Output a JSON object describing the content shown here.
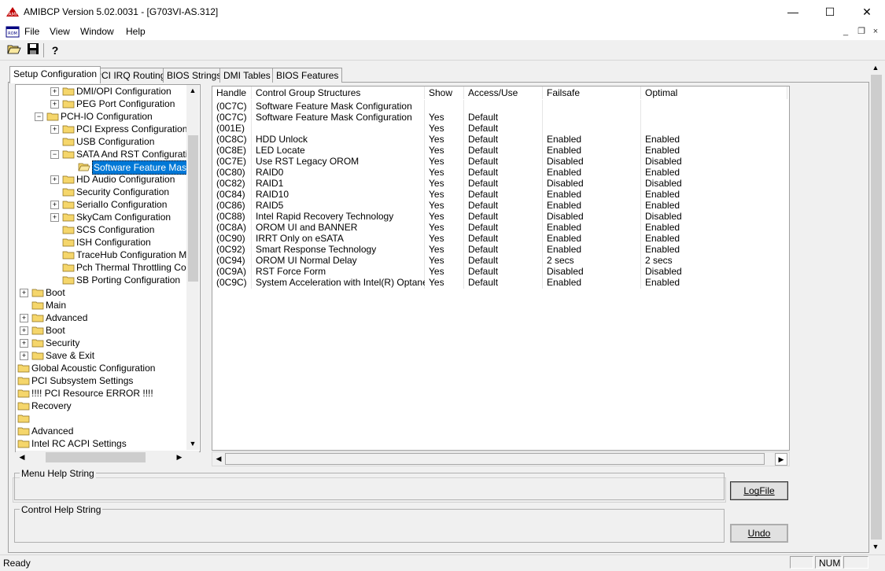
{
  "window": {
    "title": "AMIBCP Version 5.02.0031 - [G703VI-AS.312]",
    "minimize_glyph": "—",
    "maximize_glyph": "☐",
    "close_glyph": "✕"
  },
  "menubar": {
    "items": [
      "File",
      "View",
      "Window",
      "Help"
    ],
    "mdi_minimize": "_",
    "mdi_restore": "❐",
    "mdi_close": "×"
  },
  "toolbar": {
    "open_icon": "folder-open-icon",
    "save_icon": "floppy-disk-icon",
    "help_icon": "help-pointer-icon",
    "help_glyph": "?"
  },
  "tabs": [
    "Setup Configuration",
    "PCI IRQ Routing",
    "BIOS Strings",
    "DMI Tables",
    "BIOS Features"
  ],
  "tree": {
    "rows": [
      {
        "label": "DMI/OPI Configuration",
        "expander": "+"
      },
      {
        "label": "PEG Port Configuration",
        "expander": "+"
      },
      {
        "label": "PCH-IO Configuration",
        "expander": "−"
      },
      {
        "label": "PCI Express Configuration",
        "expander": "+"
      },
      {
        "label": "USB Configuration",
        "expander": ""
      },
      {
        "label": "SATA And RST Configuration",
        "expander": "−"
      },
      {
        "label": "Software Feature Mask Co",
        "expander": "",
        "selected": true
      },
      {
        "label": "HD Audio Configuration",
        "expander": "+"
      },
      {
        "label": "Security Configuration",
        "expander": ""
      },
      {
        "label": "SerialIo Configuration",
        "expander": "+"
      },
      {
        "label": "SkyCam Configuration",
        "expander": "+"
      },
      {
        "label": "SCS Configuration",
        "expander": ""
      },
      {
        "label": "ISH Configuration",
        "expander": ""
      },
      {
        "label": "TraceHub Configuration Menu",
        "expander": ""
      },
      {
        "label": "Pch Thermal Throttling Control",
        "expander": ""
      },
      {
        "label": "SB Porting Configuration",
        "expander": ""
      },
      {
        "label": "Boot",
        "expander": "+"
      },
      {
        "label": "Main",
        "expander": ""
      },
      {
        "label": "Advanced",
        "expander": "+"
      },
      {
        "label": "Boot",
        "expander": "+"
      },
      {
        "label": "Security",
        "expander": "+"
      },
      {
        "label": "Save & Exit",
        "expander": "+"
      },
      {
        "label": "Global Acoustic Configuration",
        "expander": ""
      },
      {
        "label": "PCI Subsystem Settings",
        "expander": ""
      },
      {
        "label": "!!!! PCI Resource ERROR !!!!",
        "expander": ""
      },
      {
        "label": "Recovery",
        "expander": ""
      },
      {
        "label": "",
        "expander": ""
      },
      {
        "label": "Advanced",
        "expander": ""
      },
      {
        "label": "Intel RC ACPI Settings",
        "expander": ""
      }
    ]
  },
  "grid": {
    "columns": [
      "Handle",
      "Control Group Structures",
      "Show",
      "Access/Use",
      "Failsafe",
      "Optimal"
    ],
    "rows": [
      [
        "(0C7C)",
        "Software Feature Mask Configuration",
        "",
        "",
        "",
        ""
      ],
      [
        "(0C7C)",
        "Software Feature Mask Configuration",
        "Yes",
        "Default",
        "",
        ""
      ],
      [
        "(001E)",
        "",
        "Yes",
        "Default",
        "",
        ""
      ],
      [
        "(0C8C)",
        "HDD Unlock",
        "Yes",
        "Default",
        "Enabled",
        "Enabled"
      ],
      [
        "(0C8E)",
        "LED Locate",
        "Yes",
        "Default",
        "Enabled",
        "Enabled"
      ],
      [
        "(0C7E)",
        "Use RST Legacy OROM",
        "Yes",
        "Default",
        "Disabled",
        "Disabled"
      ],
      [
        "(0C80)",
        "RAID0",
        "Yes",
        "Default",
        "Enabled",
        "Enabled"
      ],
      [
        "(0C82)",
        "RAID1",
        "Yes",
        "Default",
        "Disabled",
        "Disabled"
      ],
      [
        "(0C84)",
        "RAID10",
        "Yes",
        "Default",
        "Enabled",
        "Enabled"
      ],
      [
        "(0C86)",
        "RAID5",
        "Yes",
        "Default",
        "Enabled",
        "Enabled"
      ],
      [
        "(0C88)",
        "Intel Rapid Recovery Technology",
        "Yes",
        "Default",
        "Disabled",
        "Disabled"
      ],
      [
        "(0C8A)",
        "OROM UI and BANNER",
        "Yes",
        "Default",
        "Enabled",
        "Enabled"
      ],
      [
        "(0C90)",
        "IRRT Only on eSATA",
        "Yes",
        "Default",
        "Enabled",
        "Enabled"
      ],
      [
        "(0C92)",
        "Smart Response Technology",
        "Yes",
        "Default",
        "Enabled",
        "Enabled"
      ],
      [
        "(0C94)",
        "OROM UI Normal Delay",
        "Yes",
        "Default",
        "2 secs",
        "2 secs"
      ],
      [
        "(0C9A)",
        "RST Force Form",
        "Yes",
        "Default",
        "Disabled",
        "Disabled"
      ],
      [
        "(0C9C)",
        "System Acceleration with Intel(R) Optane(...",
        "Yes",
        "Default",
        "Enabled",
        "Enabled"
      ]
    ]
  },
  "help": {
    "menu_label": "Menu Help String",
    "control_label": "Control Help String"
  },
  "buttons": {
    "logfile": "LogFile",
    "undo": "Undo"
  },
  "statusbar": {
    "status": "Ready",
    "num": "NUM"
  },
  "colors": {
    "selection": "#0078d7",
    "folder": "#f5d66b"
  }
}
